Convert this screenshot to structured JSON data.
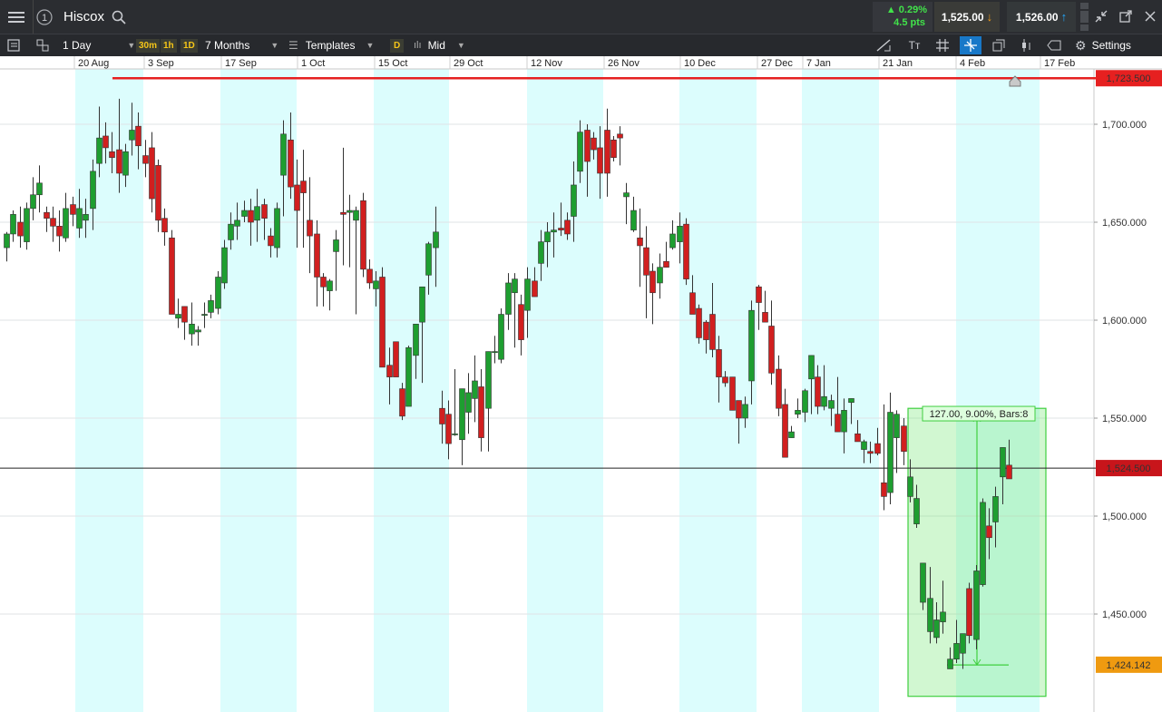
{
  "header": {
    "symbol": "Hiscox",
    "change_pct": "▲ 0.29%",
    "change_pts": "4.5 pts",
    "sell_price": "1,525.00",
    "buy_price": "1,526.00",
    "icons": [
      "menu-icon",
      "one-click-icon",
      "search-icon",
      "scroll-icon",
      "collapse-icon",
      "popout-icon",
      "close-icon"
    ]
  },
  "toolbar": {
    "interval": "1 Day",
    "quick_intervals": [
      "30m",
      "1h",
      "1D"
    ],
    "range": "7 Months",
    "templates_label": "Templates",
    "d_badge": "D",
    "price_type": "Mid",
    "settings_label": "Settings",
    "icons": [
      "layout-icon",
      "chart-type-icon",
      "draw-line-icon",
      "text-icon",
      "grid-icon",
      "crosshair-icon",
      "windows-icon",
      "candle-icon",
      "label-icon",
      "gear-icon"
    ]
  },
  "colors": {
    "up": "#1e9e30",
    "down": "#d11f1f",
    "band": "#dcfdfd",
    "resistance": "#e62020",
    "current_label": "#c8151b",
    "level_label": "#ef9a10",
    "measure": "#3fcf3f"
  },
  "chart_data": {
    "type": "candlestick",
    "x_tick_labels": [
      "20 Aug",
      "3 Sep",
      "17 Sep",
      "1 Oct",
      "15 Oct",
      "29 Oct",
      "12 Nov",
      "26 Nov",
      "10 Dec",
      "27 Dec",
      "7 Jan",
      "21 Jan",
      "4 Feb",
      "17 Feb"
    ],
    "y_tick_labels": [
      "1,700.000",
      "1,650.000",
      "1,600.000",
      "1,550.000",
      "1,500.000",
      "1,450.000"
    ],
    "y_ticks": [
      1700,
      1650,
      1600,
      1550,
      1500,
      1450
    ],
    "ylim": [
      1412,
      1740
    ],
    "resistance": {
      "value": 1723.5,
      "label": "1,723.500"
    },
    "current_price": {
      "value": 1524.5,
      "label": "1,524.500"
    },
    "level_marker": {
      "value": 1424.142,
      "label": "1,424.142"
    },
    "measurement": {
      "text": "127.00, 9.00%, Bars:8",
      "from": 1424,
      "to": 1551
    },
    "candles": [
      [
        1637,
        1644,
        1630,
        1645
      ],
      [
        1644,
        1654,
        1640,
        1656
      ],
      [
        1650,
        1643,
        1637,
        1658
      ],
      [
        1640,
        1657,
        1636,
        1660
      ],
      [
        1657,
        1664,
        1651,
        1673
      ],
      [
        1664,
        1670,
        1655,
        1679
      ],
      [
        1655,
        1652,
        1645,
        1658
      ],
      [
        1652,
        1648,
        1640,
        1658
      ],
      [
        1648,
        1643,
        1635,
        1656
      ],
      [
        1642,
        1657,
        1640,
        1665
      ],
      [
        1659,
        1654,
        1648,
        1663
      ],
      [
        1647,
        1657,
        1642,
        1667
      ],
      [
        1651,
        1654,
        1642,
        1662
      ],
      [
        1657,
        1676,
        1646,
        1682
      ],
      [
        1680,
        1693,
        1673,
        1709
      ],
      [
        1694,
        1688,
        1680,
        1701
      ],
      [
        1686,
        1683,
        1675,
        1696
      ],
      [
        1687,
        1675,
        1665,
        1713
      ],
      [
        1674,
        1686,
        1668,
        1690
      ],
      [
        1692,
        1697,
        1684,
        1711
      ],
      [
        1699,
        1689,
        1677,
        1706
      ],
      [
        1684,
        1680,
        1673,
        1692
      ],
      [
        1688,
        1662,
        1655,
        1696
      ],
      [
        1679,
        1651,
        1645,
        1682
      ],
      [
        1652,
        1645,
        1638,
        1657
      ],
      [
        1642,
        1603,
        1603,
        1646
      ],
      [
        1601,
        1603,
        1596,
        1611
      ],
      [
        1607,
        1599,
        1590,
        1607
      ],
      [
        1593,
        1598,
        1587,
        1609
      ],
      [
        1594,
        1595,
        1587,
        1597
      ],
      [
        1603,
        1603,
        1596,
        1609
      ],
      [
        1604,
        1610,
        1601,
        1613
      ],
      [
        1606,
        1622,
        1603,
        1625
      ],
      [
        1619,
        1637,
        1616,
        1641
      ],
      [
        1641,
        1649,
        1636,
        1655
      ],
      [
        1648,
        1651,
        1641,
        1660
      ],
      [
        1653,
        1656,
        1650,
        1661
      ],
      [
        1656,
        1650,
        1638,
        1662
      ],
      [
        1651,
        1658,
        1640,
        1667
      ],
      [
        1659,
        1652,
        1641,
        1662
      ],
      [
        1643,
        1638,
        1632,
        1647
      ],
      [
        1637,
        1657,
        1632,
        1660
      ],
      [
        1674,
        1695,
        1653,
        1702
      ],
      [
        1692,
        1668,
        1662,
        1706
      ],
      [
        1669,
        1656,
        1637,
        1682
      ],
      [
        1671,
        1665,
        1637,
        1687
      ],
      [
        1651,
        1643,
        1624,
        1673
      ],
      [
        1644,
        1622,
        1607,
        1651
      ],
      [
        1622,
        1617,
        1607,
        1624
      ],
      [
        1615,
        1620,
        1605,
        1621
      ],
      [
        1635,
        1641,
        1615,
        1646
      ],
      [
        1655,
        1654,
        1628,
        1688
      ],
      [
        1655,
        1656,
        1627,
        1664
      ],
      [
        1651,
        1656,
        1603,
        1658
      ],
      [
        1661,
        1626,
        1622,
        1665
      ],
      [
        1626,
        1619,
        1616,
        1631
      ],
      [
        1616,
        1620,
        1607,
        1625
      ],
      [
        1622,
        1576,
        1578,
        1627
      ],
      [
        1577,
        1571,
        1557,
        1586
      ],
      [
        1589,
        1571,
        1571,
        1588
      ],
      [
        1565,
        1551,
        1549,
        1568
      ],
      [
        1556,
        1586,
        1558,
        1587
      ],
      [
        1582,
        1598,
        1570,
        1597
      ],
      [
        1599,
        1617,
        1568,
        1600
      ],
      [
        1623,
        1639,
        1613,
        1640
      ],
      [
        1637,
        1645,
        1617,
        1658
      ],
      [
        1555,
        1547,
        1537,
        1564
      ],
      [
        1552,
        1537,
        1529,
        1559
      ],
      [
        1542,
        1542,
        1541,
        1575
      ],
      [
        1539,
        1565,
        1526,
        1559
      ],
      [
        1553,
        1563,
        1542,
        1573
      ],
      [
        1560,
        1569,
        1548,
        1582
      ],
      [
        1566,
        1540,
        1533,
        1575
      ],
      [
        1555,
        1584,
        1533,
        1582
      ],
      [
        1584,
        1584,
        1578,
        1592
      ],
      [
        1580,
        1603,
        1578,
        1606
      ],
      [
        1603,
        1619,
        1595,
        1624
      ],
      [
        1614,
        1621,
        1586,
        1624
      ],
      [
        1608,
        1590,
        1582,
        1613
      ],
      [
        1605,
        1621,
        1591,
        1627
      ],
      [
        1620,
        1612,
        1613,
        1627
      ],
      [
        1629,
        1640,
        1620,
        1646
      ],
      [
        1640,
        1645,
        1627,
        1650
      ],
      [
        1645,
        1646,
        1632,
        1655
      ],
      [
        1647,
        1646,
        1643,
        1660
      ],
      [
        1651,
        1644,
        1641,
        1655
      ],
      [
        1653,
        1669,
        1640,
        1681
      ],
      [
        1676,
        1696,
        1670,
        1702
      ],
      [
        1697,
        1681,
        1663,
        1700
      ],
      [
        1693,
        1687,
        1682,
        1696
      ],
      [
        1688,
        1675,
        1662,
        1699
      ],
      [
        1697,
        1675,
        1663,
        1708
      ],
      [
        1692,
        1683,
        1681,
        1694
      ],
      [
        1695,
        1693,
        1679,
        1699
      ],
      [
        1663,
        1665,
        1649,
        1670
      ],
      [
        1646,
        1656,
        1645,
        1663
      ],
      [
        1642,
        1638,
        1617,
        1657
      ],
      [
        1637,
        1623,
        1601,
        1648
      ],
      [
        1625,
        1614,
        1598,
        1629
      ],
      [
        1619,
        1627,
        1611,
        1634
      ],
      [
        1630,
        1627,
        1628,
        1640
      ],
      [
        1637,
        1644,
        1636,
        1651
      ],
      [
        1640,
        1648,
        1629,
        1655
      ],
      [
        1649,
        1621,
        1618,
        1652
      ],
      [
        1614,
        1603,
        1604,
        1623
      ],
      [
        1606,
        1591,
        1588,
        1608
      ],
      [
        1599,
        1590,
        1583,
        1600
      ],
      [
        1603,
        1585,
        1581,
        1619
      ],
      [
        1585,
        1571,
        1558,
        1592
      ],
      [
        1571,
        1568,
        1566,
        1574
      ],
      [
        1571,
        1554,
        1555,
        1571
      ],
      [
        1559,
        1550,
        1537,
        1559
      ],
      [
        1550,
        1557,
        1545,
        1561
      ],
      [
        1569,
        1605,
        1557,
        1610
      ],
      [
        1617,
        1609,
        1595,
        1618
      ],
      [
        1604,
        1599,
        1600,
        1615
      ],
      [
        1597,
        1573,
        1567,
        1610
      ],
      [
        1575,
        1555,
        1551,
        1582
      ],
      [
        1557,
        1530,
        1536,
        1565
      ],
      [
        1540,
        1543,
        1540,
        1546
      ],
      [
        1552,
        1554,
        1550,
        1560
      ],
      [
        1553,
        1564,
        1548,
        1565
      ],
      [
        1570,
        1582,
        1552,
        1580
      ],
      [
        1571,
        1556,
        1552,
        1577
      ],
      [
        1556,
        1561,
        1554,
        1577
      ],
      [
        1555,
        1559,
        1546,
        1562
      ],
      [
        1552,
        1543,
        1545,
        1571
      ],
      [
        1543,
        1554,
        1532,
        1560
      ],
      [
        1558,
        1560,
        1547,
        1560
      ],
      [
        1542,
        1538,
        1538,
        1549
      ],
      [
        1534,
        1538,
        1527,
        1539
      ],
      [
        1533,
        1532,
        1527,
        1538
      ],
      [
        1537,
        1532,
        1531,
        1545
      ],
      [
        1517,
        1510,
        1503,
        1557
      ],
      [
        1512,
        1553,
        1506,
        1563
      ],
      [
        1540,
        1552,
        1522,
        1554
      ],
      [
        1546,
        1533,
        1526,
        1550
      ],
      [
        1510,
        1520,
        1507,
        1529
      ],
      [
        1496,
        1509,
        1494,
        1516
      ],
      [
        1456,
        1476,
        1452,
        1468
      ],
      [
        1441,
        1458,
        1435,
        1474
      ],
      [
        1438,
        1447,
        1435,
        1456
      ],
      [
        1446,
        1451,
        1440,
        1467
      ],
      [
        1422,
        1427,
        1425,
        1433
      ],
      [
        1427,
        1435,
        1425,
        1447
      ],
      [
        1430,
        1440,
        1422,
        1434
      ],
      [
        1463,
        1439,
        1435,
        1466
      ],
      [
        1437,
        1472,
        1432,
        1475
      ],
      [
        1465,
        1507,
        1464,
        1509
      ],
      [
        1495,
        1489,
        1478,
        1504
      ],
      [
        1497,
        1510,
        1484,
        1515
      ],
      [
        1520,
        1535,
        1506,
        1535
      ],
      [
        1526,
        1519,
        1521,
        1539
      ]
    ]
  }
}
